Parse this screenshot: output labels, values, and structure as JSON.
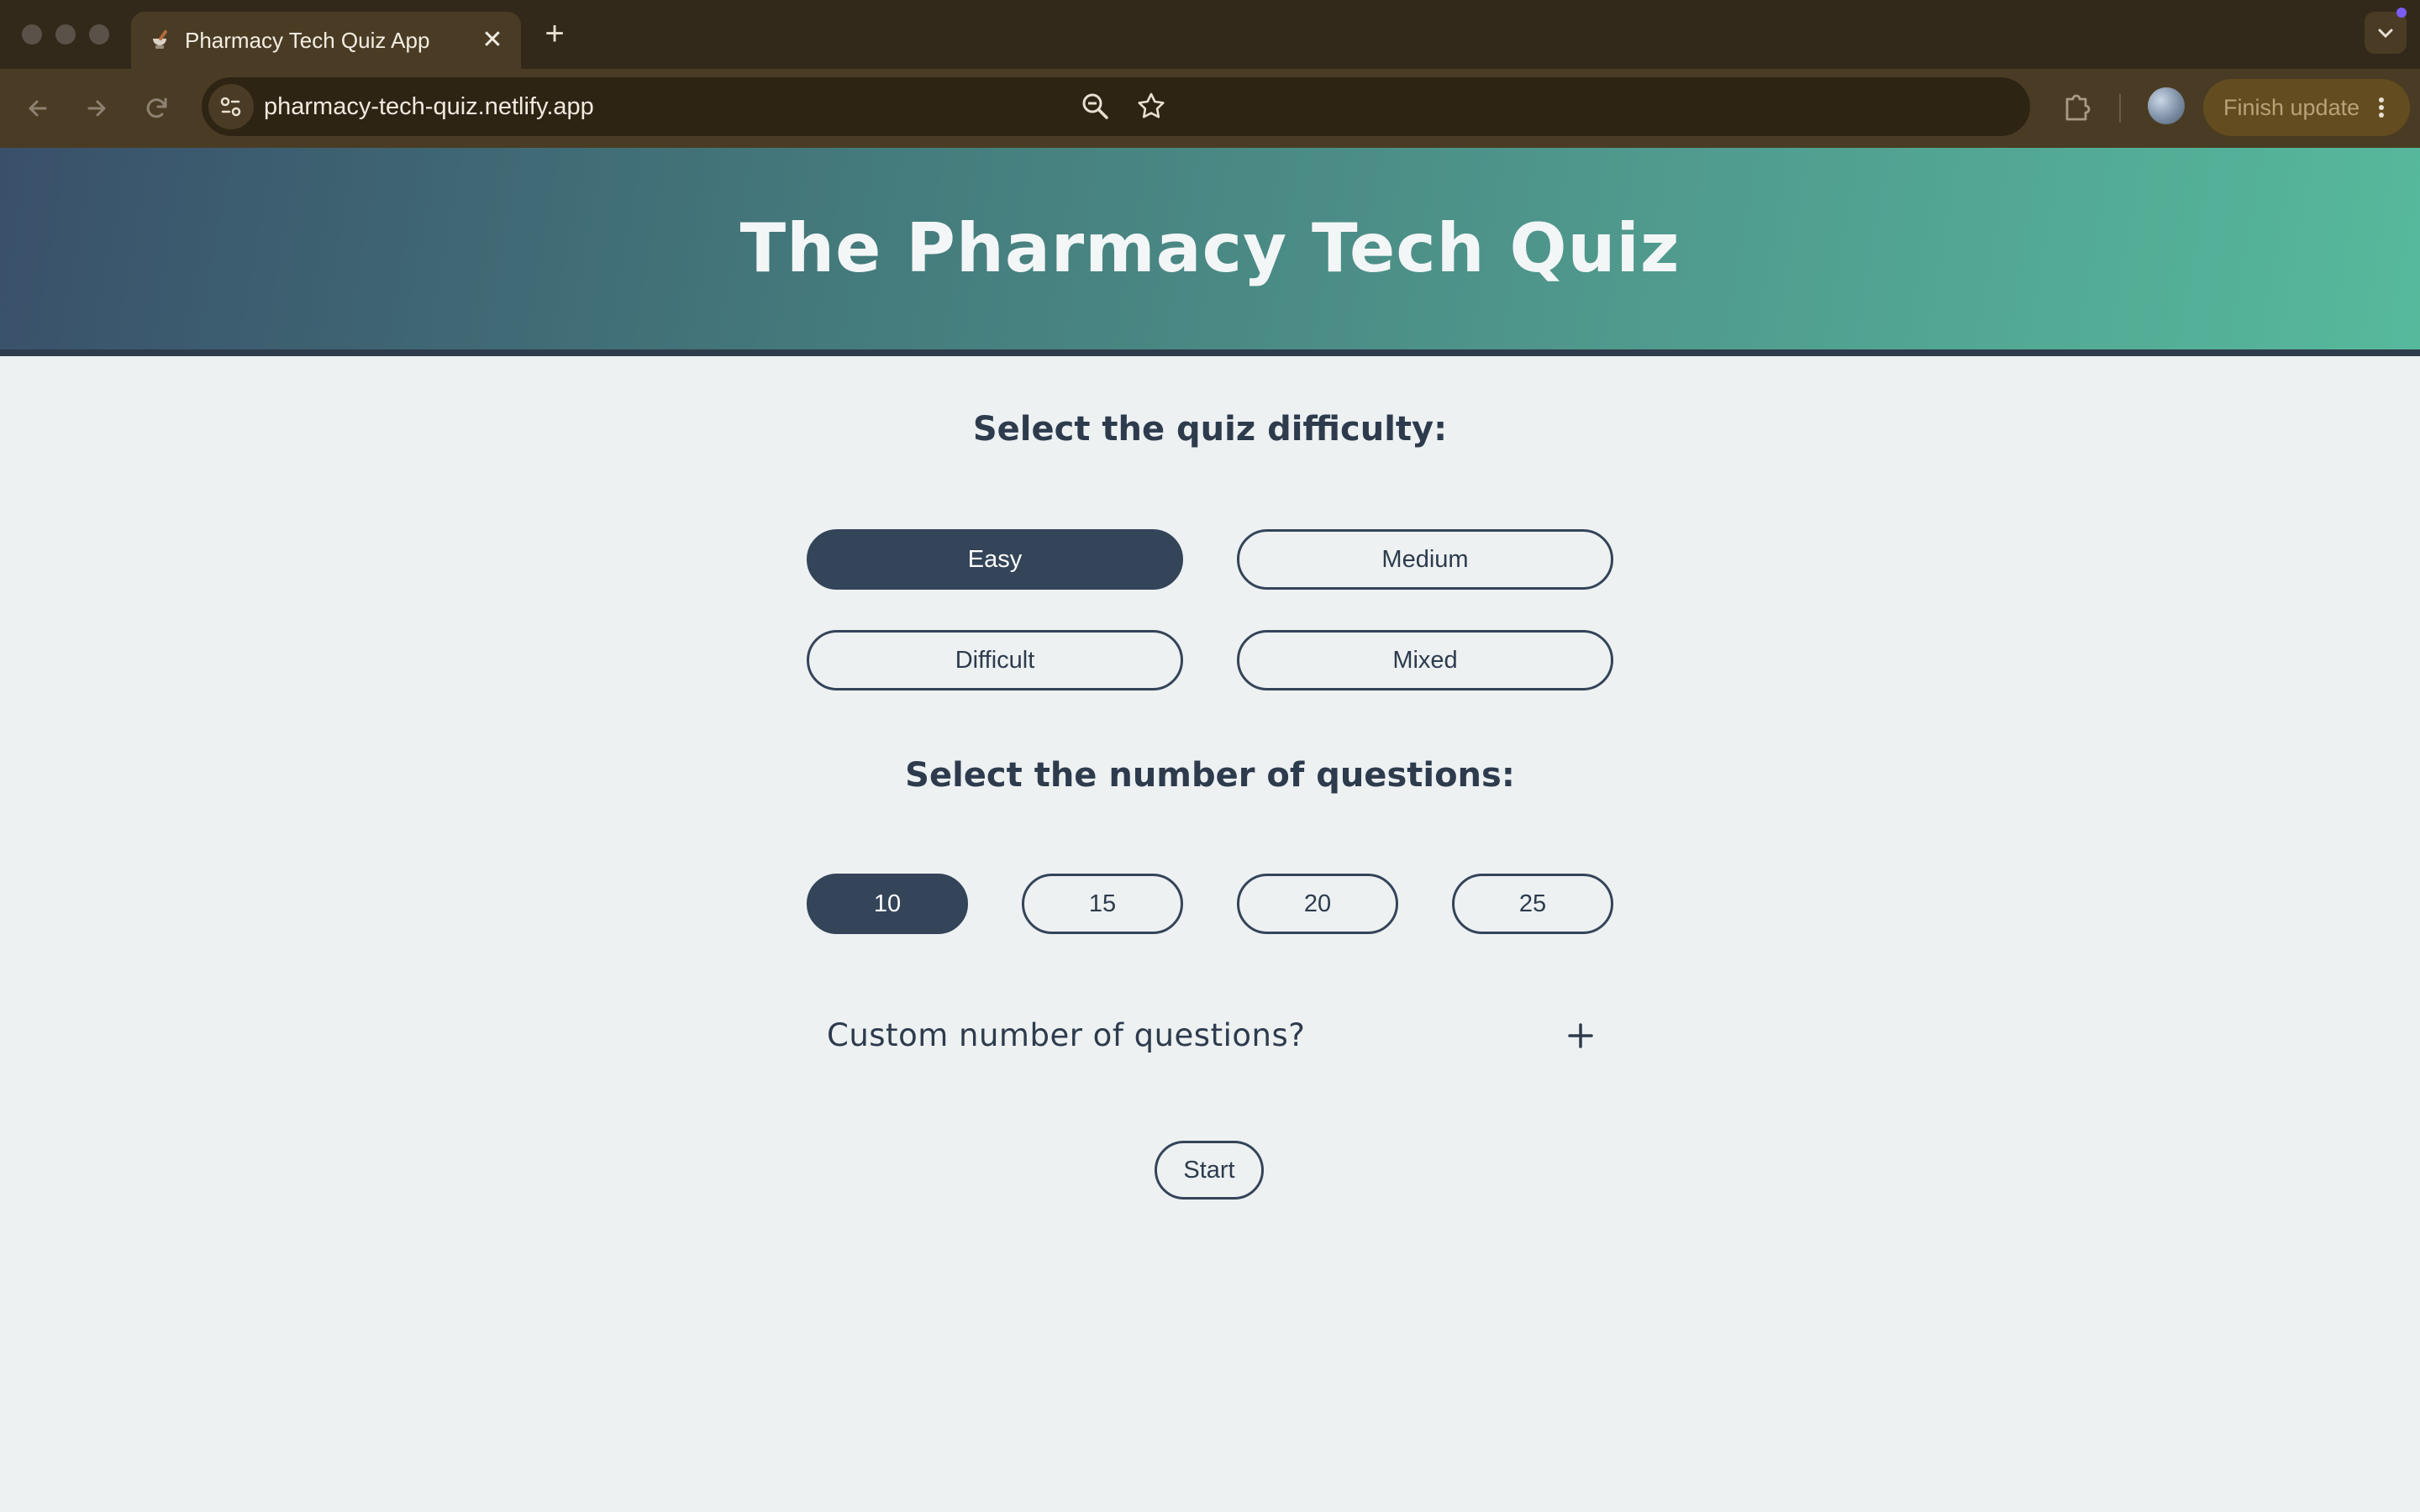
{
  "browser": {
    "tab_title": "Pharmacy Tech Quiz App",
    "url": "pharmacy-tech-quiz.netlify.app",
    "finish_update_label": "Finish update"
  },
  "page": {
    "title": "The Pharmacy Tech Quiz",
    "difficulty_heading": "Select the quiz difficulty:",
    "difficulty_options": [
      "Easy",
      "Medium",
      "Difficult",
      "Mixed"
    ],
    "difficulty_selected": "Easy",
    "count_heading": "Select the number of questions:",
    "count_options": [
      "10",
      "15",
      "20",
      "25"
    ],
    "count_selected": "10",
    "custom_label": "Custom number of questions?",
    "start_label": "Start"
  },
  "colors": {
    "primary": "#344459",
    "background": "#edf1f2",
    "header_gradient_start": "#39506a",
    "header_gradient_end": "#56b99c"
  },
  "icons": {
    "tab_favicon": "mortar-pestle-icon",
    "custom_toggle": "plus-icon"
  }
}
